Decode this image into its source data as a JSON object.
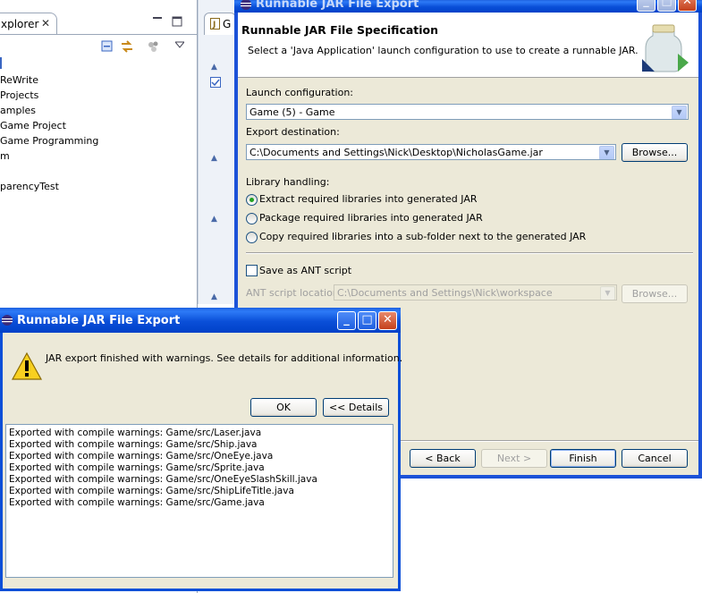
{
  "explorer": {
    "tab_label": "xplorer",
    "close_glyph": "✕",
    "tree_items": [
      "ReWrite",
      "Projects",
      "amples",
      "Game Project",
      "Game Programming",
      "m",
      "",
      "parencyTest"
    ]
  },
  "editor": {
    "tab_label": "G"
  },
  "wizard": {
    "title": "Runnable JAR File Export",
    "header_title": "Runnable JAR File Specification",
    "header_desc": "Select a 'Java Application' launch configuration to use to create a runnable JAR.",
    "launch_label": "Launch configuration:",
    "launch_value": "Game (5) - Game",
    "dest_label": "Export destination:",
    "dest_value": "C:\\Documents and Settings\\Nick\\Desktop\\NicholasGame.jar",
    "browse_label": "Browse...",
    "library_label": "Library handling:",
    "library_options": [
      "Extract required libraries into generated JAR",
      "Package required libraries into generated JAR",
      "Copy required libraries into a sub-folder next to the generated JAR"
    ],
    "library_selected": 0,
    "ant_checkbox_label": "Save as ANT script",
    "ant_location_label": "ANT script location:",
    "ant_location_value": "C:\\Documents and Settings\\Nick\\workspace",
    "ant_browse_label": "Browse...",
    "back_label": "< Back",
    "next_label": "Next >",
    "finish_label": "Finish",
    "cancel_label": "Cancel"
  },
  "message": {
    "title": "Runnable JAR File Export",
    "text": "JAR export finished with warnings. See details for additional information.",
    "ok_label": "OK",
    "details_label": "<< Details",
    "details_lines": [
      "Exported with compile warnings: Game/src/Laser.java",
      "Exported with compile warnings: Game/src/Ship.java",
      "Exported with compile warnings: Game/src/OneEye.java",
      "Exported with compile warnings: Game/src/Sprite.java",
      "Exported with compile warnings: Game/src/OneEyeSlashSkill.java",
      "Exported with compile warnings: Game/src/ShipLifeTitle.java",
      "Exported with compile warnings: Game/src/Game.java"
    ]
  },
  "colors": {
    "xp_titlebar": "#0a4fd8",
    "dialog_face": "#ece9d8",
    "radio_dot": "#21a121"
  }
}
